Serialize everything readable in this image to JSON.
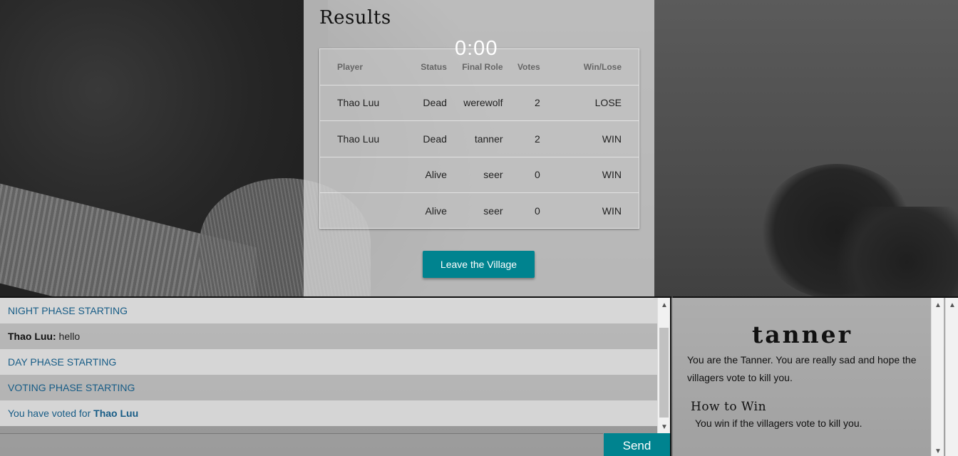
{
  "results": {
    "title": "Results",
    "timer": "0:00",
    "columns": [
      "Player",
      "Status",
      "Final Role",
      "Votes",
      "Win/Lose"
    ],
    "rows": [
      {
        "player": "Thao Luu",
        "status": "Dead",
        "role": "werewolf",
        "votes": "2",
        "outcome": "LOSE"
      },
      {
        "player": "Thao Luu",
        "status": "Dead",
        "role": "tanner",
        "votes": "2",
        "outcome": "WIN"
      },
      {
        "player": "",
        "status": "Alive",
        "role": "seer",
        "votes": "0",
        "outcome": "WIN"
      },
      {
        "player": "",
        "status": "Alive",
        "role": "seer",
        "votes": "0",
        "outcome": "WIN"
      }
    ],
    "leave_label": "Leave the Village"
  },
  "chat": {
    "messages": [
      {
        "type": "system",
        "text": "NIGHT PHASE STARTING"
      },
      {
        "type": "user",
        "author": "Thao Luu:",
        "text": " hello"
      },
      {
        "type": "system",
        "text": "DAY PHASE STARTING"
      },
      {
        "type": "system",
        "text": "VOTING PHASE STARTING"
      },
      {
        "type": "vote",
        "text": "You have voted for ",
        "target": "Thao Luu"
      }
    ],
    "input_value": "",
    "send_label": "Send"
  },
  "role": {
    "name": "tanner",
    "description": "You are the Tanner. You are really sad and hope the villagers vote to kill you.",
    "how_to_win_title": "How to Win",
    "how_to_win_text": "You win if the villagers vote to kill you."
  },
  "icons": {
    "scroll_up": "chevron-up-icon",
    "scroll_down": "chevron-down-icon"
  },
  "colors": {
    "accent": "#00838f",
    "system_message": "#175c86"
  }
}
